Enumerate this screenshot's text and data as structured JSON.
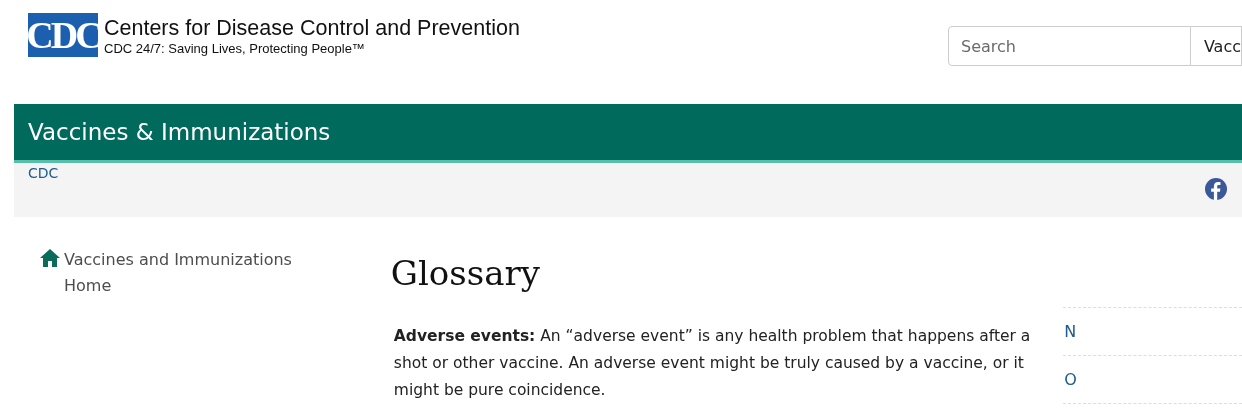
{
  "header": {
    "logo_mark": "CDC",
    "title": "Centers for Disease Control and Prevention",
    "tagline": "CDC 24/7: Saving Lives, Protecting People™",
    "search": {
      "placeholder": "Search",
      "scope": "Vacc"
    }
  },
  "banner": {
    "title": "Vaccines & Immunizations"
  },
  "breadcrumb": {
    "items": [
      "CDC"
    ]
  },
  "sidebar": {
    "items": [
      {
        "label": "Vaccines and Immunizations Home",
        "kind": "home"
      }
    ]
  },
  "page": {
    "title": "Glossary",
    "entries": [
      {
        "text": "**Adverse events:** An “adverse event” is any health problem that happens after a shot or other vaccine. An adverse event might be truly caused by a vaccine, or it might be pure coincidence."
      }
    ]
  },
  "index": {
    "letters": [
      "N",
      "O"
    ]
  }
}
